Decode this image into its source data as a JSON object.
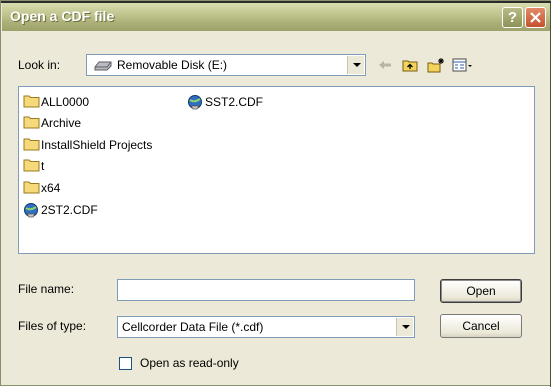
{
  "dialog": {
    "title": "Open a CDF file"
  },
  "look_in": {
    "label": "Look in:",
    "value": "Removable Disk (E:)",
    "icon": "drive-icon"
  },
  "toolbar": {
    "back": "back-arrow-icon",
    "up": "up-folder-icon",
    "new_folder": "new-folder-icon",
    "view_menu": "view-menu-icon"
  },
  "files": [
    {
      "name": "ALL0000",
      "type": "folder"
    },
    {
      "name": "Archive",
      "type": "folder"
    },
    {
      "name": "InstallShield Projects",
      "type": "folder"
    },
    {
      "name": "t",
      "type": "folder"
    },
    {
      "name": "x64",
      "type": "folder"
    },
    {
      "name": "2ST2.CDF",
      "type": "cdf"
    },
    {
      "name": "SST2.CDF",
      "type": "cdf"
    }
  ],
  "file_name": {
    "label": "File name:",
    "value": "",
    "placeholder": ""
  },
  "file_type": {
    "label": "Files of type:",
    "value": "Cellcorder Data File (*.cdf)"
  },
  "buttons": {
    "open": "Open",
    "cancel": "Cancel"
  },
  "read_only": {
    "label": "Open as read-only",
    "checked": false
  },
  "colors": {
    "title_bar": "#abb077",
    "dialog_bg": "#ece9d8",
    "close_button": "#c5512e",
    "field_border": "#7f9db9"
  }
}
